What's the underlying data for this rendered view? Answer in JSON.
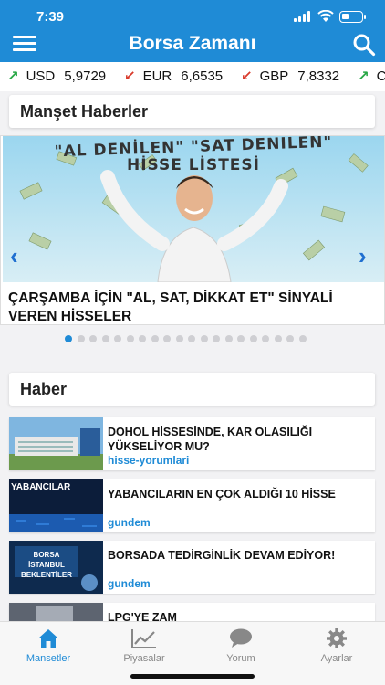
{
  "status_bar": {
    "time": "7:39"
  },
  "header": {
    "title": "Borsa Zamanı"
  },
  "ticker": [
    {
      "direction": "up",
      "code": "USD",
      "value": "5,9729"
    },
    {
      "direction": "down",
      "code": "EUR",
      "value": "6,6535"
    },
    {
      "direction": "down",
      "code": "GBP",
      "value": "7,8332"
    },
    {
      "direction": "up",
      "code": "C",
      "value": ""
    }
  ],
  "headlines_section": {
    "title": "Manşet Haberler"
  },
  "carousel": {
    "banner_line1": "\"AL DENİLEN\" \"SAT DENİLEN\"",
    "banner_line2": "HİSSE LİSTESİ",
    "caption": "ÇARŞAMBA İÇİN \"AL, SAT, DİKKAT ET\" SİNYALİ VEREN HİSSELER",
    "dot_count": 20,
    "active_index": 0
  },
  "news_section": {
    "title": "Haber"
  },
  "news": [
    {
      "title": "DOHOL HİSSESİNDE, KAR OLASILIĞI YÜKSELİYOR MU?",
      "category": "hisse-yorumlari",
      "thumb_text": ""
    },
    {
      "title": "YABANCILARIN EN ÇOK ALDIĞI 10 HİSSE",
      "category": "gundem",
      "thumb_text": "YABANCILAR"
    },
    {
      "title": "BORSADA TEDİRGİNLİK DEVAM EDİYOR!",
      "category": "gundem",
      "thumb_text": "BORSA İSTANBUL BEKLENTİLER"
    },
    {
      "title": "LPG'YE ZAM",
      "category": "",
      "thumb_text": ""
    }
  ],
  "tabs": [
    {
      "label": "Mansetler",
      "icon": "home-icon",
      "active": true
    },
    {
      "label": "Piyasalar",
      "icon": "chart-icon",
      "active": false
    },
    {
      "label": "Yorum",
      "icon": "chat-icon",
      "active": false
    },
    {
      "label": "Ayarlar",
      "icon": "gear-icon",
      "active": false
    }
  ],
  "colors": {
    "brand": "#1f8bd6",
    "up": "#27a745",
    "down": "#d93a2b"
  }
}
